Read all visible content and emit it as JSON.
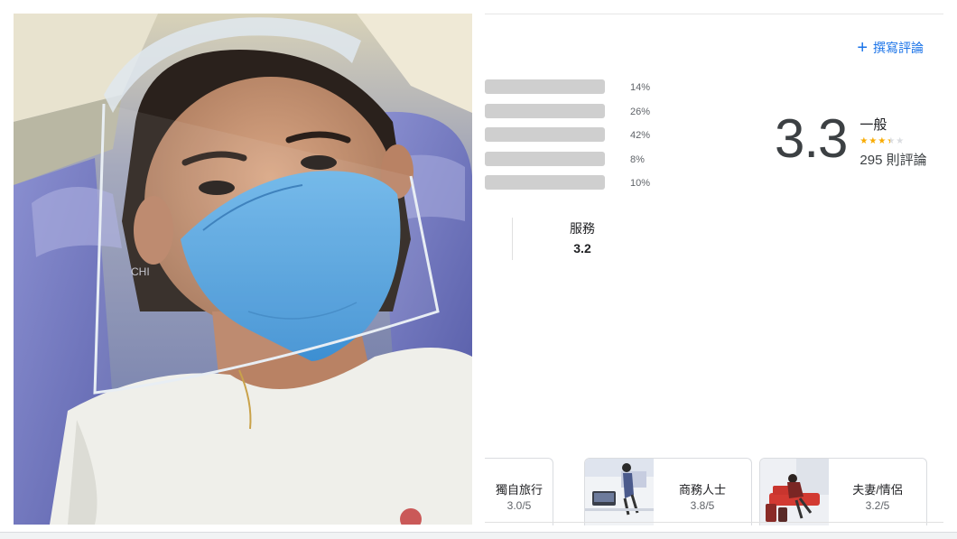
{
  "photo": {
    "icon": "traveler-selfie-photo"
  },
  "reviews": {
    "write_review_label": "撰寫評論",
    "distribution": [
      {
        "percent_label": "14%",
        "fraction": 0.14
      },
      {
        "percent_label": "26%",
        "fraction": 0.26
      },
      {
        "percent_label": "42%",
        "fraction": 0.42
      },
      {
        "percent_label": "8%",
        "fraction": 0.08
      },
      {
        "percent_label": "10%",
        "fraction": 0.1
      }
    ],
    "score": "3.3",
    "score_label": "一般",
    "stars": 3.3,
    "count_label": "295 則評論",
    "sub_rating": {
      "label": "服務",
      "value": "3.2"
    },
    "traveler_types": [
      {
        "title": "獨自旅行",
        "rating": "3.0/5",
        "icon": "solo-travel-image"
      },
      {
        "title": "商務人士",
        "rating": "3.8/5",
        "icon": "business-travel-image"
      },
      {
        "title": "夫妻/情侶",
        "rating": "3.2/5",
        "icon": "couples-travel-image"
      }
    ]
  },
  "colors": {
    "accent": "#1a73e8",
    "star": "#f9ab00",
    "bar": "#cfcfcf"
  }
}
